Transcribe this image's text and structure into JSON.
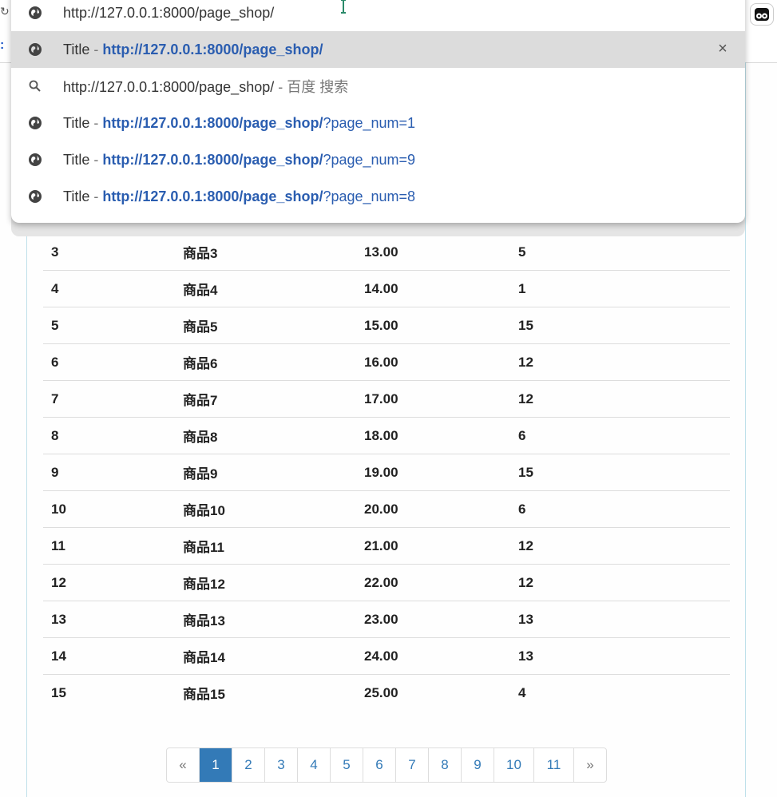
{
  "omnibox": {
    "input_text": "http://127.0.0.1:8000/page_shop/",
    "suggestions": [
      {
        "title": "Title",
        "sep": " - ",
        "url": "http://127.0.0.1:8000/page_shop/",
        "query": "",
        "icon": "globe-icon"
      },
      {
        "title": "http://127.0.0.1:8000/page_shop/",
        "sep": " - ",
        "engine": "百度 搜索",
        "icon": "search-icon"
      },
      {
        "title": "Title",
        "sep": " - ",
        "url": "http://127.0.0.1:8000/page_shop/",
        "query": "?page_num=1",
        "icon": "globe-icon"
      },
      {
        "title": "Title",
        "sep": " - ",
        "url": "http://127.0.0.1:8000/page_shop/",
        "query": "?page_num=9",
        "icon": "globe-icon"
      },
      {
        "title": "Title",
        "sep": " - ",
        "url": "http://127.0.0.1:8000/page_shop/",
        "query": "?page_num=8",
        "icon": "globe-icon"
      }
    ],
    "close_label": "×"
  },
  "table": {
    "rows": [
      [
        "3",
        "商品3",
        "13.00",
        "5"
      ],
      [
        "4",
        "商品4",
        "14.00",
        "1"
      ],
      [
        "5",
        "商品5",
        "15.00",
        "15"
      ],
      [
        "6",
        "商品6",
        "16.00",
        "12"
      ],
      [
        "7",
        "商品7",
        "17.00",
        "12"
      ],
      [
        "8",
        "商品8",
        "18.00",
        "6"
      ],
      [
        "9",
        "商品9",
        "19.00",
        "15"
      ],
      [
        "10",
        "商品10",
        "20.00",
        "6"
      ],
      [
        "11",
        "商品11",
        "21.00",
        "12"
      ],
      [
        "12",
        "商品12",
        "22.00",
        "12"
      ],
      [
        "13",
        "商品13",
        "23.00",
        "13"
      ],
      [
        "14",
        "商品14",
        "24.00",
        "13"
      ],
      [
        "15",
        "商品15",
        "25.00",
        "4"
      ]
    ]
  },
  "pagination": {
    "prev": "«",
    "pages": [
      "1",
      "2",
      "3",
      "4",
      "5",
      "6",
      "7",
      "8",
      "9",
      "10",
      "11"
    ],
    "active": "1",
    "next": "»"
  },
  "colors": {
    "link": "#2a5db0",
    "active_page": "#337ab7",
    "selected_row": "#dcdcdc"
  }
}
